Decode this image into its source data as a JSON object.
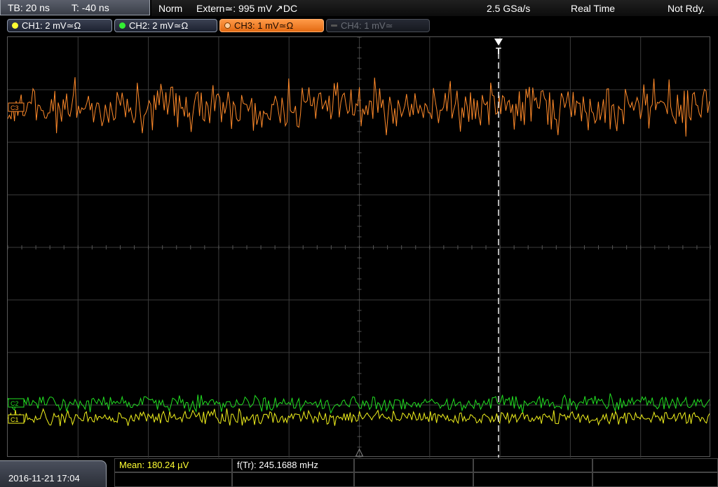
{
  "topbar": {
    "timebase": "TB: 20 ns",
    "trigger_time": "T: -40 ns",
    "trigger_mode": "Norm",
    "trigger_source": "Extern≃: 995 mV ↗DC",
    "sample_rate": "2.5 GSa/s",
    "acq_mode": "Real Time",
    "status": "Not Rdy."
  },
  "channels": [
    {
      "label": "CH1: 2 mV≃Ω",
      "color": "#ffff33",
      "state": "on"
    },
    {
      "label": "CH2: 2 mV≃Ω",
      "color": "#33ee33",
      "state": "on"
    },
    {
      "label": "CH3: 1 mV≃Ω",
      "color": "#ff8c30",
      "state": "active"
    },
    {
      "label": "CH4: 1 mV≃",
      "color": "#666666",
      "state": "off"
    }
  ],
  "markers": {
    "ch3": "C3",
    "ch2": "C2",
    "ch1": "C1",
    "trigger": "T"
  },
  "colors": {
    "ch1": "#f2f21c",
    "ch2": "#22e022",
    "ch3": "#ff8a2a",
    "grid": "#3c3c3c"
  },
  "footer": {
    "datetime": "2016-11-21 17:04",
    "mean": "Mean: 180.24 µV",
    "freq": "f(Tr): 245.1688 mHz"
  }
}
